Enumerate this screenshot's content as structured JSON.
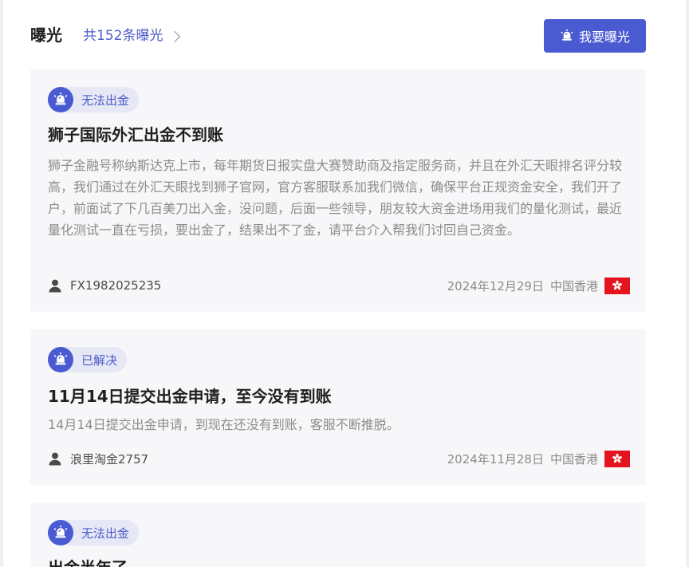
{
  "header": {
    "title": "曝光",
    "count_link": "共152条曝光",
    "expose_button": "我要曝光"
  },
  "colors": {
    "accent": "#4a5bd1",
    "card_bg": "#f7f7f9",
    "tag_bg": "#e7e8f6",
    "flag_red": "#e4141e"
  },
  "cards": [
    {
      "tag": "无法出金",
      "tag_icon": "alarm-icon",
      "title": "狮子国际外汇出金不到账",
      "body": "狮子金融号称纳斯达克上市，每年期货日报实盘大赛赞助商及指定服务商，并且在外汇天眼排名评分较高，我们通过在外汇天眼找到狮子官网，官方客服联系加我们微信，确保平台正规资金安全，我们开了户，前面试了下几百美刀出入金，没问题，后面一些领导，朋友较大资金进场用我们的量化测试，最近量化测试一直在亏损，要出金了，结果出不了金，请平台介入帮我们讨回自己资金。",
      "user": "FX1982025235",
      "date": "2024年12月29日",
      "region": "中国香港",
      "flag_icon": "hong-kong-flag-icon"
    },
    {
      "tag": "已解决",
      "tag_icon": "alarm-icon",
      "title": "11月14日提交出金申请，至今没有到账",
      "body": "14月14日提交出金申请，到现在还没有到账，客服不断推脱。",
      "user": "浪里淘金2757",
      "date": "2024年11月28日",
      "region": "中国香港",
      "flag_icon": "hong-kong-flag-icon"
    },
    {
      "tag": "无法出金",
      "tag_icon": "alarm-icon",
      "title": "出金半年了"
    }
  ]
}
